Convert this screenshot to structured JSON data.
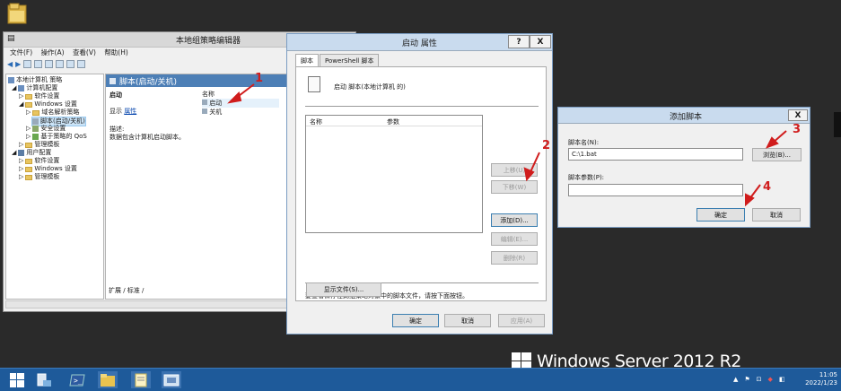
{
  "desktop": {
    "folder_icon": "folder-icon",
    "branding": "Windows Server 2012 R2"
  },
  "gpe_window": {
    "title": "本地组策略编辑器",
    "menu": [
      "文件(F)",
      "操作(A)",
      "查看(V)",
      "帮助(H)"
    ],
    "tree": [
      "本地计算机 策略",
      "计算机配置",
      "软件设置",
      "Windows 设置",
      "域名解析策略",
      "脚本(启动/关机)",
      "安全设置",
      "基于策略的 QoS",
      "管理模板",
      "用户配置",
      "软件设置",
      "Windows 设置",
      "管理模板"
    ],
    "pane_header": "脚本(启动/关机)",
    "selected_title": "启动",
    "show_label": "显示",
    "properties_link": "属性",
    "desc_label": "描述:",
    "desc_text": "数据包含计算机启动脚本。",
    "col_name": "名称",
    "items": [
      "启动",
      "关机"
    ],
    "bottom_tabs": "扩展 / 标准 /"
  },
  "props_dialog": {
    "title": "启动 属性",
    "help_btn": "?",
    "close_btn": "X",
    "tabs": [
      "脚本",
      "PowerShell 脚本"
    ],
    "heading": "启动 脚本(本地计算机 的)",
    "col_name": "名称",
    "col_params": "参数",
    "btn_up": "上移(U)",
    "btn_down": "下移(W)",
    "btn_add": "添加(D)...",
    "btn_edit": "编辑(E)...",
    "btn_delete": "删除(R)",
    "info_text": "要查看保存在此组策略对象中的脚本文件，请按下面按钮。",
    "btn_show_files": "显示文件(S)...",
    "btn_ok": "确定",
    "btn_cancel": "取消",
    "btn_apply": "应用(A)"
  },
  "add_dialog": {
    "title": "添加脚本",
    "close_btn": "X",
    "name_label": "脚本名(N):",
    "name_value": "C:\\1.bat",
    "browse_btn": "浏览(B)...",
    "params_label": "脚本参数(P):",
    "params_value": "",
    "btn_ok": "确定",
    "btn_cancel": "取消"
  },
  "annotations": [
    "1",
    "2",
    "3",
    "4"
  ],
  "taskbar": {
    "time": "11:05",
    "date": "2022/1/23"
  }
}
